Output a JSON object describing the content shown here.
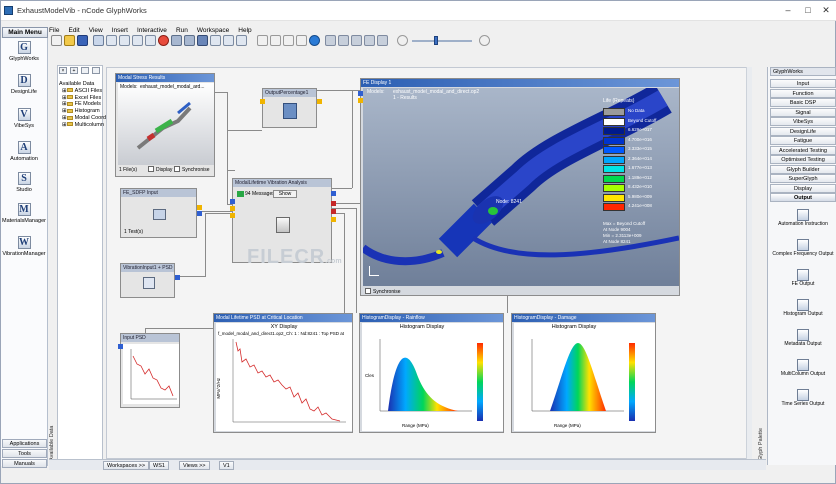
{
  "window": {
    "title": "ExhaustModelVib - nCode GlyphWorks"
  },
  "main_menu_label": "Main Menu",
  "menu": [
    "File",
    "Edit",
    "View",
    "Insert",
    "Interactive",
    "Run",
    "Workspace",
    "Help"
  ],
  "left_sidebar": {
    "items": [
      {
        "label": "GlyphWorks",
        "icon": "glyphworks-icon",
        "glyph": "G"
      },
      {
        "label": "DesignLife",
        "icon": "designlife-icon",
        "glyph": "D"
      },
      {
        "label": "VibeSys",
        "icon": "vibesys-icon",
        "glyph": "V"
      },
      {
        "label": "Automation",
        "icon": "automation-icon",
        "glyph": "A"
      },
      {
        "label": "Studio",
        "icon": "studio-icon",
        "glyph": "S"
      },
      {
        "label": "MaterialsManager",
        "icon": "materials-manager-icon",
        "glyph": "M"
      },
      {
        "label": "VibrationManager",
        "icon": "vibration-manager-icon",
        "glyph": "W"
      }
    ],
    "bottom": [
      "Applications",
      "Tools",
      "Manuals"
    ]
  },
  "side_tab": "Available Data",
  "tree": {
    "header": "Available Data",
    "items": [
      "ASCII Files",
      "Excel Files",
      "FE Models",
      "Histogram",
      "Modal Coordinates",
      "Multicolumn"
    ]
  },
  "nodes": {
    "modal_stress": {
      "title": "Modal Stress Results",
      "line1": "Models:",
      "line2": "exhaust_model_modal_ard...",
      "files": "1 File(s)",
      "display": "Display",
      "synchronise": "Synchronise"
    },
    "fe_input": {
      "title": "FE_SDFP Input",
      "value": "1 Test(s)"
    },
    "vibration_input": {
      "title": "VibrationInput1 + PSD"
    },
    "output_percent": {
      "title": "OutputPercentage1"
    },
    "modal_lifetime": {
      "title": "ModalLifetime Vibration Analysis",
      "messages": "94 Messages",
      "show_label": "Show"
    },
    "fe_display": {
      "title": "FE Display 1",
      "line1": "Models:",
      "line2": "exhaust_model_modal_and_direct.op2",
      "line3": "1 - Results",
      "legend_title": "Life (Repeats)",
      "legend_values": [
        "No Data",
        "Beyond Cutoff",
        "6.629e+017",
        "4.700e+016",
        "3.333e+015",
        "2.364e+014",
        "1.677e+013",
        "1.189e+012",
        "8.432e+010",
        "5.980e+009",
        "4.241e+008"
      ],
      "legend_colors": [
        "#9b9b9b",
        "#ffffff",
        "#001a8c",
        "#0033cc",
        "#0059ff",
        "#00a6ff",
        "#00e5e5",
        "#00d94d",
        "#a6ff00",
        "#ffe600",
        "#ff2600"
      ],
      "legend_notes": [
        "Max = Beyond Cutoff",
        "At Node 9004",
        "Min = 2.3113e+009",
        "At Node 8241"
      ],
      "probe_label": "Node: 8241",
      "synchronise": "Synchronise"
    },
    "input_psd": {
      "title": "Input PSD"
    },
    "xy_display": {
      "title": "Modal Lifetime PSD at Critical Location",
      "chart_title": "XY Display",
      "subtitle": "f_model_modal_and_direct1.op2_Ch: 1 : Nd:8241 : Top PSD at",
      "ylabel": "MPa^2/Hz"
    },
    "hist_rainflow": {
      "title": "HistogramDisplay - Rainflow",
      "chart_title": "Histogram Display",
      "xlabel": "Range (MPa)",
      "ylabel": "Cles"
    },
    "hist_damage": {
      "title": "HistogramDisplay - Damage",
      "chart_title": "Histogram Display",
      "xlabel": "Range (MPa)"
    }
  },
  "watermark": {
    "brand": "FILECR",
    "suffix": ".com"
  },
  "right_panel": {
    "header": "GlyphWorks",
    "items": [
      "Input",
      "Function",
      "Basic DSP",
      "Signal",
      "VibeSys",
      "DesignLife",
      "Fatigue",
      "Accelerated Testing",
      "Optimised Testing",
      "Glyph Builder",
      "SuperGlyph",
      "Display",
      "Output"
    ],
    "selected": "Output",
    "tools": [
      "Automation Instruction",
      "Complex Frequency Output",
      "FE Output",
      "Histogram Output",
      "Metadata Output",
      "MultiColumn Output",
      "Time Series Output"
    ],
    "side_tab": "Glyph Palette"
  },
  "status_bar": {
    "workspaces": "Workspaces >>",
    "ws": "WS1",
    "views": "Views >>",
    "view": "V1"
  }
}
